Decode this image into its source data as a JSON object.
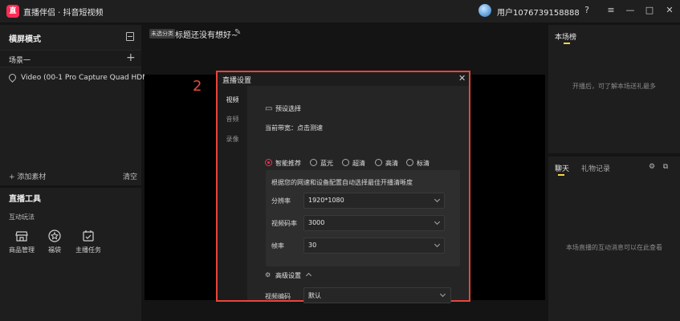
{
  "app": {
    "logo_text": "直",
    "title": "直播伴侣 · 抖音短视频",
    "username": "用户1076739158888",
    "help_icon": "?",
    "menu_icon": "≡",
    "minimize_icon": "—",
    "maximize_icon": "□",
    "close_icon": "✕"
  },
  "left": {
    "title": "横屏模式",
    "scene_tab": "场景一",
    "add_scene_icon": "+",
    "source_label": "Video (00-1 Pro Capture Quad HDMI)",
    "add_material": "+ 添加素材",
    "clear": "清空"
  },
  "tools": {
    "title": "直播工具",
    "section": "互动玩法",
    "items": [
      "商品管理",
      "福袋",
      "主播任务"
    ]
  },
  "center": {
    "badge": "未选分类",
    "title": "标题还没有想好~",
    "edit_icon": "✎",
    "step_label": "2"
  },
  "right": {
    "rank_title": "本场榜",
    "rank_empty": "开播后，可了解本场送礼最多",
    "chat_tab": "聊天",
    "gift_tab": "礼物记录",
    "settings_icon": "⚙",
    "popout_icon": "⧉",
    "chat_empty": "本场直播的互动消息可以在此查看"
  },
  "dialog": {
    "title": "直播设置",
    "close_icon": "✕",
    "tabs": [
      "视频",
      "音频",
      "录像"
    ],
    "preset_title": "预设选择",
    "bandwidth": "当前带宽：点击测速",
    "presets": [
      "智能推荐",
      "蓝光",
      "超清",
      "高清",
      "标清"
    ],
    "selected_preset": "智能推荐",
    "auto_hint": "根据您的网速和设备配置自动选择最佳开播清晰度",
    "params": [
      {
        "label": "分辨率",
        "value": "1920*1080"
      },
      {
        "label": "视频码率",
        "value": "3000"
      },
      {
        "label": "帧率",
        "value": "30"
      }
    ],
    "advanced": "高级设置",
    "encoder_label": "视频编码",
    "encoder_value": "默认"
  },
  "colors": {
    "accent": "#fe2c55",
    "highlight_border": "#e8453b",
    "tab_underline": "#f7d547"
  }
}
